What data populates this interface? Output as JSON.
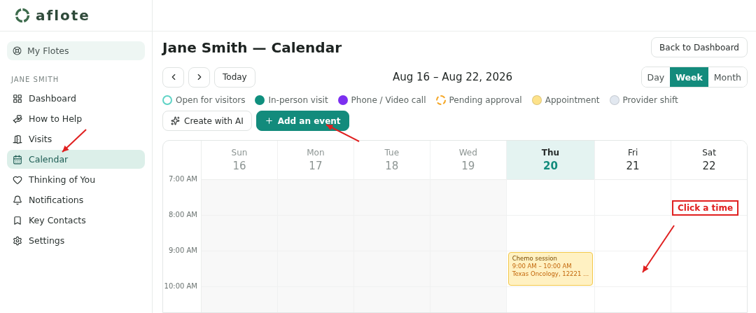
{
  "brand": {
    "name": "aflote"
  },
  "sidebar": {
    "top_item": {
      "label": "My Flotes"
    },
    "section": "JANE SMITH",
    "items": [
      {
        "label": "Dashboard",
        "selected": false
      },
      {
        "label": "How to Help",
        "selected": false
      },
      {
        "label": "Visits",
        "selected": false
      },
      {
        "label": "Calendar",
        "selected": true
      },
      {
        "label": "Thinking of You",
        "selected": false
      },
      {
        "label": "Notifications",
        "selected": false
      },
      {
        "label": "Key Contacts",
        "selected": false
      },
      {
        "label": "Settings",
        "selected": false
      }
    ]
  },
  "page": {
    "title": "Jane Smith — Calendar",
    "back_button": "Back to Dashboard"
  },
  "toolbar": {
    "today": "Today",
    "range": "Aug 16 – Aug 22, 2026",
    "views": [
      {
        "label": "Day",
        "selected": false
      },
      {
        "label": "Week",
        "selected": true
      },
      {
        "label": "Month",
        "selected": false
      }
    ]
  },
  "legend": [
    {
      "label": "Open for visitors",
      "kind": "ring",
      "color": "#5fd3c6"
    },
    {
      "label": "In-person visit",
      "kind": "dot",
      "color": "#0f8f7e"
    },
    {
      "label": "Phone / Video call",
      "kind": "dot",
      "color": "#7c2ff0"
    },
    {
      "label": "Pending approval",
      "kind": "dashed",
      "color": "#f5a623"
    },
    {
      "label": "Appointment",
      "kind": "soft",
      "color": "#fde28a"
    },
    {
      "label": "Provider shift",
      "kind": "soft",
      "color": "#e2e8f0"
    }
  ],
  "actions": {
    "ai": "Create with AI",
    "add": "Add an event"
  },
  "hours": [
    "7:00 AM",
    "8:00 AM",
    "9:00 AM",
    "10:00 AM"
  ],
  "days": [
    {
      "name": "Sun",
      "date": "16",
      "past": true,
      "today": false
    },
    {
      "name": "Mon",
      "date": "17",
      "past": true,
      "today": false
    },
    {
      "name": "Tue",
      "date": "18",
      "past": true,
      "today": false
    },
    {
      "name": "Wed",
      "date": "19",
      "past": true,
      "today": false
    },
    {
      "name": "Thu",
      "date": "20",
      "past": false,
      "today": true,
      "cells": [
        {},
        {},
        {
          "event": {
            "title": "Chemo session",
            "time": "9:00 AM – 10:00 AM",
            "place": "Texas Oncology, 12221 ..."
          }
        },
        {}
      ]
    },
    {
      "name": "Fri",
      "date": "21",
      "past": false,
      "today": false
    },
    {
      "name": "Sat",
      "date": "22",
      "past": false,
      "today": false
    }
  ],
  "annotation": {
    "text": "Click a time"
  }
}
